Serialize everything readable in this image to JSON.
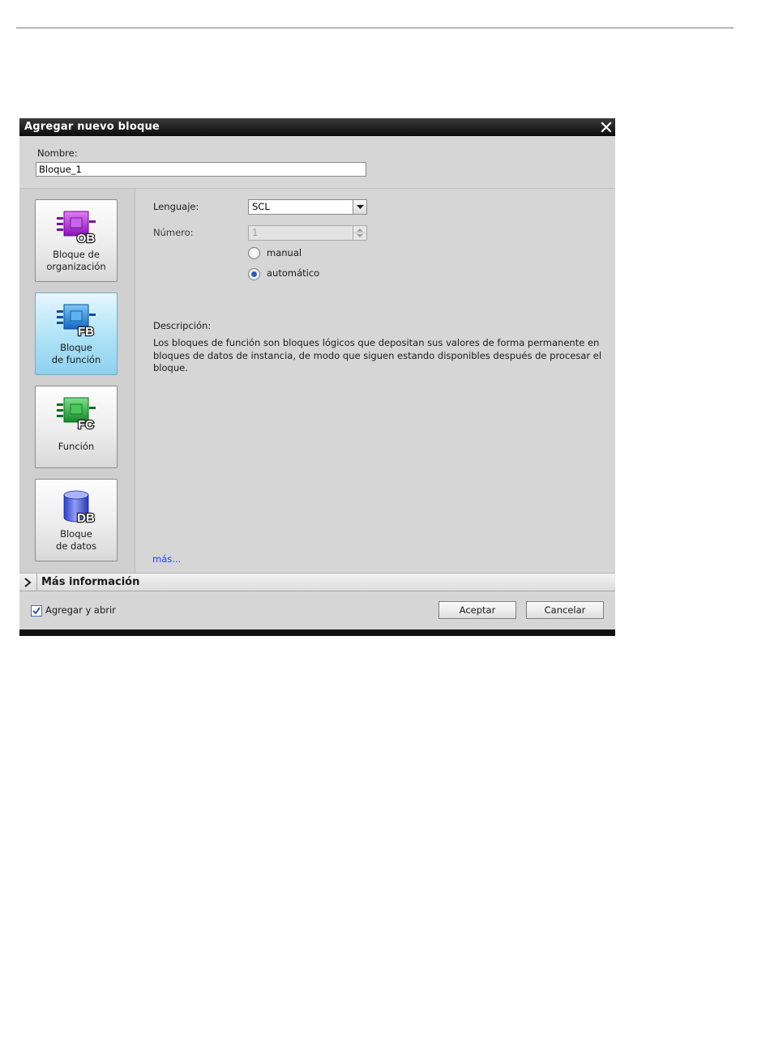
{
  "dialog": {
    "title": "Agregar nuevo bloque",
    "name_label": "Nombre:",
    "name_value": "Bloque_1"
  },
  "block_types": [
    {
      "line1": "Bloque de",
      "line2": "organización",
      "icon_text": "OB",
      "icon": "organization-block-icon",
      "color": "#a21bd0",
      "selected": false
    },
    {
      "line1": "Bloque",
      "line2": "de función",
      "icon_text": "FB",
      "icon": "function-block-icon",
      "color": "#1c82d6",
      "selected": true
    },
    {
      "line1": "Función",
      "line2": "",
      "icon_text": "FC",
      "icon": "function-icon",
      "color": "#1ea63a",
      "selected": false
    },
    {
      "line1": "Bloque",
      "line2": "de datos",
      "icon_text": "DB",
      "icon": "data-block-icon",
      "color": "#4a5ed8",
      "selected": false
    }
  ],
  "form": {
    "language_label": "Lenguaje:",
    "language_value": "SCL",
    "number_label": "Número:",
    "number_value": "1",
    "radio_manual": "manual",
    "radio_auto": "automático",
    "selected_radio": "automático"
  },
  "description": {
    "label": "Descripción:",
    "text": "Los bloques de función son bloques lógicos que depositan sus valores de forma permanente en bloques de datos de instancia, de modo que siguen estando disponibles después de procesar el bloque.",
    "more_link": "más..."
  },
  "more_info": {
    "label": "Más información"
  },
  "footer": {
    "checkbox_label": "Agregar y abrir",
    "checkbox_checked": true,
    "ok_label": "Aceptar",
    "cancel_label": "Cancelar"
  },
  "colors": {
    "title_bar": "#111111",
    "dialog_bg": "#d6d6d6",
    "link": "#1a3cff",
    "check": "#2a5db0"
  }
}
